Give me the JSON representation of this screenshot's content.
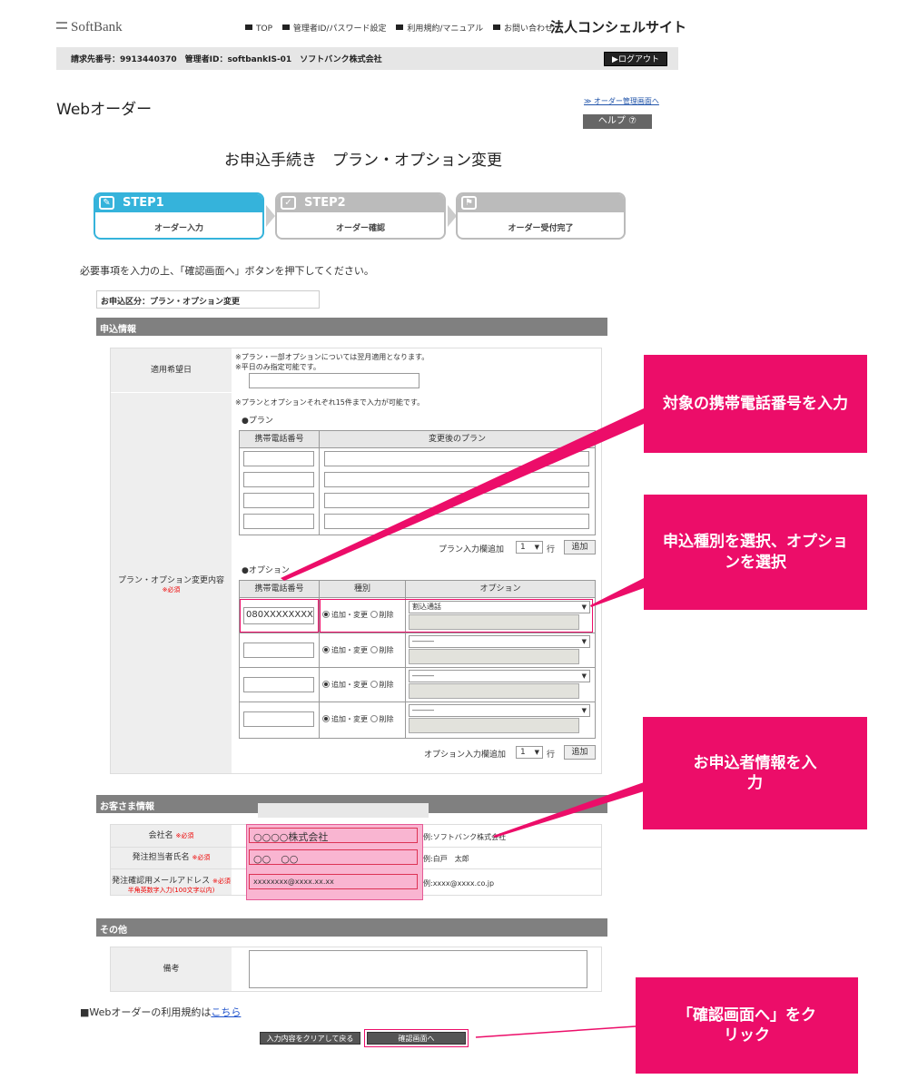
{
  "header": {
    "logo": "SoftBank",
    "nav": [
      "TOP",
      "管理者ID/パスワード設定",
      "利用規約/マニュアル",
      "お問い合わせ"
    ],
    "site_title": "法人コンシェルサイト",
    "account_info": "請求先番号：9913440370　管理者ID：softbankIS-01　ソフトバンク株式会社",
    "logout": "▶ログアウト"
  },
  "page": {
    "title": "Webオーダー",
    "admin_link": "≫ オーダー管理画面へ",
    "help": "ヘルプ ⑦",
    "heading": "お申込手続き　プラン・オプション変更"
  },
  "steps": [
    {
      "label": "STEP1",
      "sub": "オーダー入力",
      "icon": "✎"
    },
    {
      "label": "STEP2",
      "sub": "オーダー確認",
      "icon": "✓"
    },
    {
      "label": "",
      "sub": "オーダー受付完了",
      "icon": "⚑"
    }
  ],
  "instruction": "必要事項を入力の上、「確認画面へ」ボタンを押下してください。",
  "kubun": "お申込区分：プラン・オプション変更",
  "moushikomi": {
    "title": "申込情報",
    "tekiyo_label": "適用希望日",
    "tekiyo_note1": "※プラン・一部オプションについては翌月適用となります。",
    "tekiyo_note2": "※平日のみ指定可能です。",
    "plan_label": "プラン・オプション変更内容",
    "required": "※必須",
    "plan_note": "※プランとオプションそれぞれ15件まで入力が可能です。",
    "plan_title": "●プラン",
    "plan_headers": [
      "携帯電話番号",
      "変更後のプラン"
    ],
    "plan_add_label": "プラン入力欄追加",
    "add_count": "1",
    "row_unit": "行",
    "add_button": "追加",
    "option_title": "●オプション",
    "option_headers": [
      "携帯電話番号",
      "種別",
      "オプション"
    ],
    "option_rows": [
      {
        "phone": "080XXXXXXXX",
        "select": "割込通話"
      },
      {
        "phone": "",
        "select": "―――"
      },
      {
        "phone": "",
        "select": "―――"
      },
      {
        "phone": "",
        "select": "―――"
      }
    ],
    "radio_add": "追加・変更",
    "radio_del": "削除",
    "option_add_label": "オプション入力欄追加"
  },
  "customer": {
    "title": "お客さま情報",
    "rows": [
      {
        "label": "会社名",
        "value": "○○○○株式会社",
        "example": "例:ソフトバンク株式会社"
      },
      {
        "label": "発注担当者氏名",
        "value": "○○　○○",
        "example": "例:白戸　太郎"
      },
      {
        "label": "発注確認用メールアドレス",
        "value": "xxxxxxxx@xxxx.xx.xx",
        "example": "例:xxxx@xxxx.co.jp"
      }
    ],
    "email_note": "半角英数字入力(100文字以内)"
  },
  "other": {
    "title": "その他",
    "remarks_label": "備考"
  },
  "terms": {
    "prefix": "■Webオーダーの利用規約は",
    "link": "こちら"
  },
  "buttons": {
    "clear": "入力内容をクリアして戻る",
    "confirm": "確認画面へ"
  },
  "callouts": [
    "対象の携帯電話番号を入力",
    "申込種別を選択、オプションを選択",
    "お申込者情報を入力",
    "「確認画面へ」をクリック"
  ],
  "colors": {
    "accent": "#ec0d69",
    "step_active": "#35b3db",
    "section": "#808080"
  }
}
